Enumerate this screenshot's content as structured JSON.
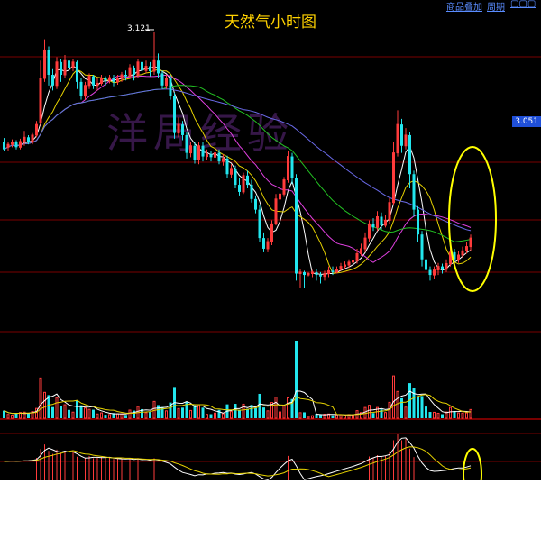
{
  "chart_title": "天然气小时图",
  "top_links": [
    "商品叠加",
    "周期",
    "▢▢▢"
  ],
  "watermark": "洋局经验",
  "peak_label": "3.121",
  "price_tag": "3.051",
  "colors": {
    "up": "#ff3b3b",
    "down": "#22e6ee",
    "ma_white": "#ffffff",
    "ma_yellow": "#e6d200",
    "ma_magenta": "#e040e0",
    "ma_green": "#22c022",
    "ma_blue": "#6a6ae8",
    "highlight": "#ffff00",
    "grid": "#7a0000"
  },
  "chart_data": {
    "type": "candlestick",
    "title": "天然气小时图",
    "ylim": [
      2.74,
      3.14
    ],
    "candles": [
      [
        2.966,
        2.955,
        2.971,
        2.952
      ],
      [
        2.958,
        2.962,
        2.966,
        2.953
      ],
      [
        2.962,
        2.965,
        2.969,
        2.958
      ],
      [
        2.965,
        2.958,
        2.968,
        2.955
      ],
      [
        2.958,
        2.966,
        2.97,
        2.955
      ],
      [
        2.966,
        2.972,
        2.981,
        2.96
      ],
      [
        2.972,
        2.965,
        2.975,
        2.962
      ],
      [
        2.965,
        2.975,
        2.978,
        2.962
      ],
      [
        2.975,
        2.99,
        2.995,
        2.972
      ],
      [
        2.992,
        3.055,
        3.08,
        2.988
      ],
      [
        3.055,
        3.095,
        3.11,
        3.05
      ],
      [
        3.095,
        3.06,
        3.1,
        3.045
      ],
      [
        3.06,
        3.045,
        3.068,
        3.038
      ],
      [
        3.045,
        3.078,
        3.085,
        3.04
      ],
      [
        3.078,
        3.06,
        3.082,
        3.05
      ],
      [
        3.06,
        3.08,
        3.088,
        3.055
      ],
      [
        3.08,
        3.07,
        3.085,
        3.06
      ],
      [
        3.07,
        3.078,
        3.082,
        3.065
      ],
      [
        3.078,
        3.05,
        3.08,
        3.04
      ],
      [
        3.05,
        3.03,
        3.055,
        3.025
      ],
      [
        3.03,
        3.045,
        3.05,
        3.025
      ],
      [
        3.045,
        3.058,
        3.062,
        3.04
      ],
      [
        3.058,
        3.045,
        3.06,
        3.04
      ],
      [
        3.045,
        3.048,
        3.055,
        3.038
      ],
      [
        3.048,
        3.055,
        3.06,
        3.045
      ],
      [
        3.055,
        3.052,
        3.058,
        3.045
      ],
      [
        3.052,
        3.056,
        3.06,
        3.048
      ],
      [
        3.056,
        3.05,
        3.06,
        3.044
      ],
      [
        3.05,
        3.055,
        3.06,
        3.046
      ],
      [
        3.055,
        3.06,
        3.064,
        3.05
      ],
      [
        3.06,
        3.058,
        3.066,
        3.052
      ],
      [
        3.058,
        3.07,
        3.075,
        3.055
      ],
      [
        3.07,
        3.06,
        3.073,
        3.052
      ],
      [
        3.06,
        3.078,
        3.082,
        3.055
      ],
      [
        3.078,
        3.066,
        3.085,
        3.06
      ],
      [
        3.066,
        3.072,
        3.08,
        3.062
      ],
      [
        3.072,
        3.065,
        3.078,
        3.058
      ],
      [
        3.065,
        3.08,
        3.121,
        3.06
      ],
      [
        3.08,
        3.062,
        3.09,
        3.055
      ],
      [
        3.062,
        3.045,
        3.066,
        3.04
      ],
      [
        3.045,
        3.055,
        3.06,
        3.04
      ],
      [
        3.055,
        3.03,
        3.06,
        3.025
      ],
      [
        3.03,
        2.978,
        3.035,
        2.97
      ],
      [
        2.978,
        2.99,
        3.0,
        2.972
      ],
      [
        2.99,
        2.975,
        2.995,
        2.968
      ],
      [
        2.975,
        2.95,
        2.98,
        2.942
      ],
      [
        2.95,
        2.96,
        2.966,
        2.944
      ],
      [
        2.96,
        2.94,
        2.965,
        2.935
      ],
      [
        2.94,
        2.96,
        2.966,
        2.934
      ],
      [
        2.96,
        2.945,
        2.965,
        2.938
      ],
      [
        2.945,
        2.948,
        2.955,
        2.94
      ],
      [
        2.948,
        2.944,
        2.952,
        2.938
      ],
      [
        2.944,
        2.95,
        2.956,
        2.94
      ],
      [
        2.95,
        2.938,
        2.955,
        2.934
      ],
      [
        2.938,
        2.942,
        2.948,
        2.932
      ],
      [
        2.942,
        2.92,
        2.946,
        2.915
      ],
      [
        2.92,
        2.928,
        2.934,
        2.914
      ],
      [
        2.928,
        2.905,
        2.932,
        2.9
      ],
      [
        2.905,
        2.895,
        2.915,
        2.89
      ],
      [
        2.895,
        2.918,
        2.922,
        2.892
      ],
      [
        2.918,
        2.905,
        2.925,
        2.9
      ],
      [
        2.905,
        2.885,
        2.912,
        2.88
      ],
      [
        2.885,
        2.87,
        2.89,
        2.865
      ],
      [
        2.87,
        2.83,
        2.876,
        2.824
      ],
      [
        2.83,
        2.815,
        2.838,
        2.81
      ],
      [
        2.815,
        2.825,
        2.83,
        2.81
      ],
      [
        2.825,
        2.85,
        2.855,
        2.82
      ],
      [
        2.85,
        2.885,
        2.892,
        2.848
      ],
      [
        2.885,
        2.892,
        2.9,
        2.88
      ],
      [
        2.892,
        2.912,
        2.916,
        2.888
      ],
      [
        2.912,
        2.945,
        2.952,
        2.908
      ],
      [
        2.945,
        2.915,
        2.95,
        2.906
      ],
      [
        2.915,
        2.78,
        2.92,
        2.77
      ],
      [
        2.78,
        2.782,
        2.786,
        2.76
      ],
      [
        2.782,
        2.778,
        2.784,
        2.76
      ],
      [
        2.778,
        2.78,
        2.782,
        2.776
      ],
      [
        2.78,
        2.782,
        2.785,
        2.775
      ],
      [
        2.782,
        2.778,
        2.786,
        2.77
      ],
      [
        2.778,
        2.776,
        2.782,
        2.766
      ],
      [
        2.776,
        2.78,
        2.784,
        2.77
      ],
      [
        2.78,
        2.784,
        2.79,
        2.775
      ],
      [
        2.784,
        2.782,
        2.79,
        2.778
      ],
      [
        2.782,
        2.786,
        2.79,
        2.78
      ],
      [
        2.786,
        2.79,
        2.795,
        2.784
      ],
      [
        2.79,
        2.792,
        2.797,
        2.786
      ],
      [
        2.792,
        2.796,
        2.8,
        2.788
      ],
      [
        2.796,
        2.798,
        2.804,
        2.79
      ],
      [
        2.798,
        2.808,
        2.815,
        2.794
      ],
      [
        2.808,
        2.815,
        2.822,
        2.805
      ],
      [
        2.815,
        2.83,
        2.838,
        2.81
      ],
      [
        2.83,
        2.85,
        2.855,
        2.825
      ],
      [
        2.85,
        2.845,
        2.858,
        2.84
      ],
      [
        2.845,
        2.86,
        2.868,
        2.84
      ],
      [
        2.86,
        2.848,
        2.866,
        2.842
      ],
      [
        2.848,
        2.855,
        2.862,
        2.845
      ],
      [
        2.855,
        2.88,
        2.886,
        2.85
      ],
      [
        2.88,
        2.95,
        2.965,
        2.876
      ],
      [
        2.95,
        2.99,
        3.01,
        2.945
      ],
      [
        2.99,
        2.96,
        2.998,
        2.95
      ],
      [
        2.96,
        2.975,
        2.985,
        2.955
      ],
      [
        2.975,
        2.92,
        2.98,
        2.9
      ],
      [
        2.92,
        2.87,
        2.925,
        2.86
      ],
      [
        2.87,
        2.835,
        2.875,
        2.825
      ],
      [
        2.835,
        2.8,
        2.84,
        2.79
      ],
      [
        2.8,
        2.785,
        2.805,
        2.772
      ],
      [
        2.785,
        2.778,
        2.79,
        2.77
      ],
      [
        2.778,
        2.785,
        2.79,
        2.772
      ],
      [
        2.785,
        2.79,
        2.795,
        2.778
      ],
      [
        2.79,
        2.786,
        2.794,
        2.78
      ],
      [
        2.786,
        2.794,
        2.8,
        2.782
      ],
      [
        2.794,
        2.81,
        2.816,
        2.79
      ],
      [
        2.81,
        2.8,
        2.815,
        2.796
      ],
      [
        2.8,
        2.806,
        2.812,
        2.795
      ],
      [
        2.806,
        2.812,
        2.818,
        2.802
      ],
      [
        2.812,
        2.818,
        2.825,
        2.808
      ],
      [
        2.818,
        2.83,
        2.835,
        2.812
      ]
    ]
  }
}
